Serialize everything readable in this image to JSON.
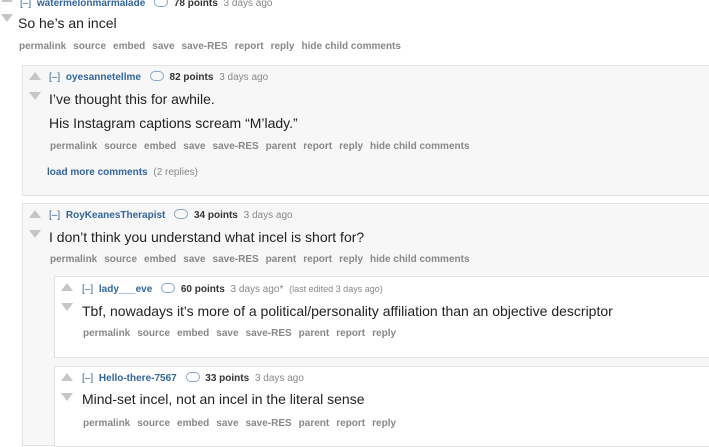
{
  "comments": [
    {
      "collapse": "[–]",
      "author": "watermelonmarmalade",
      "points": "78 points",
      "time": "3 days ago",
      "body": [
        "So he’s an incel"
      ],
      "buttons": [
        "permalink",
        "source",
        "embed",
        "save",
        "save-RES",
        "report",
        "reply",
        "hide child comments"
      ]
    },
    {
      "collapse": "[–]",
      "author": "oyesannetellme",
      "points": "82 points",
      "time": "3 days ago",
      "body": [
        "I’ve thought this for awhile.",
        "His Instagram captions scream “M’lady.”"
      ],
      "buttons": [
        "permalink",
        "source",
        "embed",
        "save",
        "save-RES",
        "parent",
        "report",
        "reply",
        "hide child comments"
      ],
      "load_more": {
        "label": "load more comments",
        "count": "(2 replies)"
      }
    },
    {
      "collapse": "[–]",
      "author": "RoyKeanesTherapist",
      "points": "34 points",
      "time": "3 days ago",
      "body": [
        "I don’t think you understand what incel is short for?"
      ],
      "buttons": [
        "permalink",
        "source",
        "embed",
        "save",
        "save-RES",
        "parent",
        "report",
        "reply",
        "hide child comments"
      ]
    },
    {
      "collapse": "[–]",
      "author": "lady___eve",
      "points": "60 points",
      "time": "3 days ago*",
      "edited": "(last edited 3 days ago)",
      "body": [
        "Tbf, nowadays it's more of a political/personality affiliation than an objective descriptor"
      ],
      "buttons": [
        "permalink",
        "source",
        "embed",
        "save",
        "save-RES",
        "parent",
        "report",
        "reply"
      ]
    },
    {
      "collapse": "[–]",
      "author": "Hello-there-7567",
      "points": "33 points",
      "time": "3 days ago",
      "body": [
        "Mind-set incel, not an incel in the literal sense"
      ],
      "buttons": [
        "permalink",
        "source",
        "embed",
        "save",
        "save-RES",
        "parent",
        "report",
        "reply"
      ]
    }
  ]
}
